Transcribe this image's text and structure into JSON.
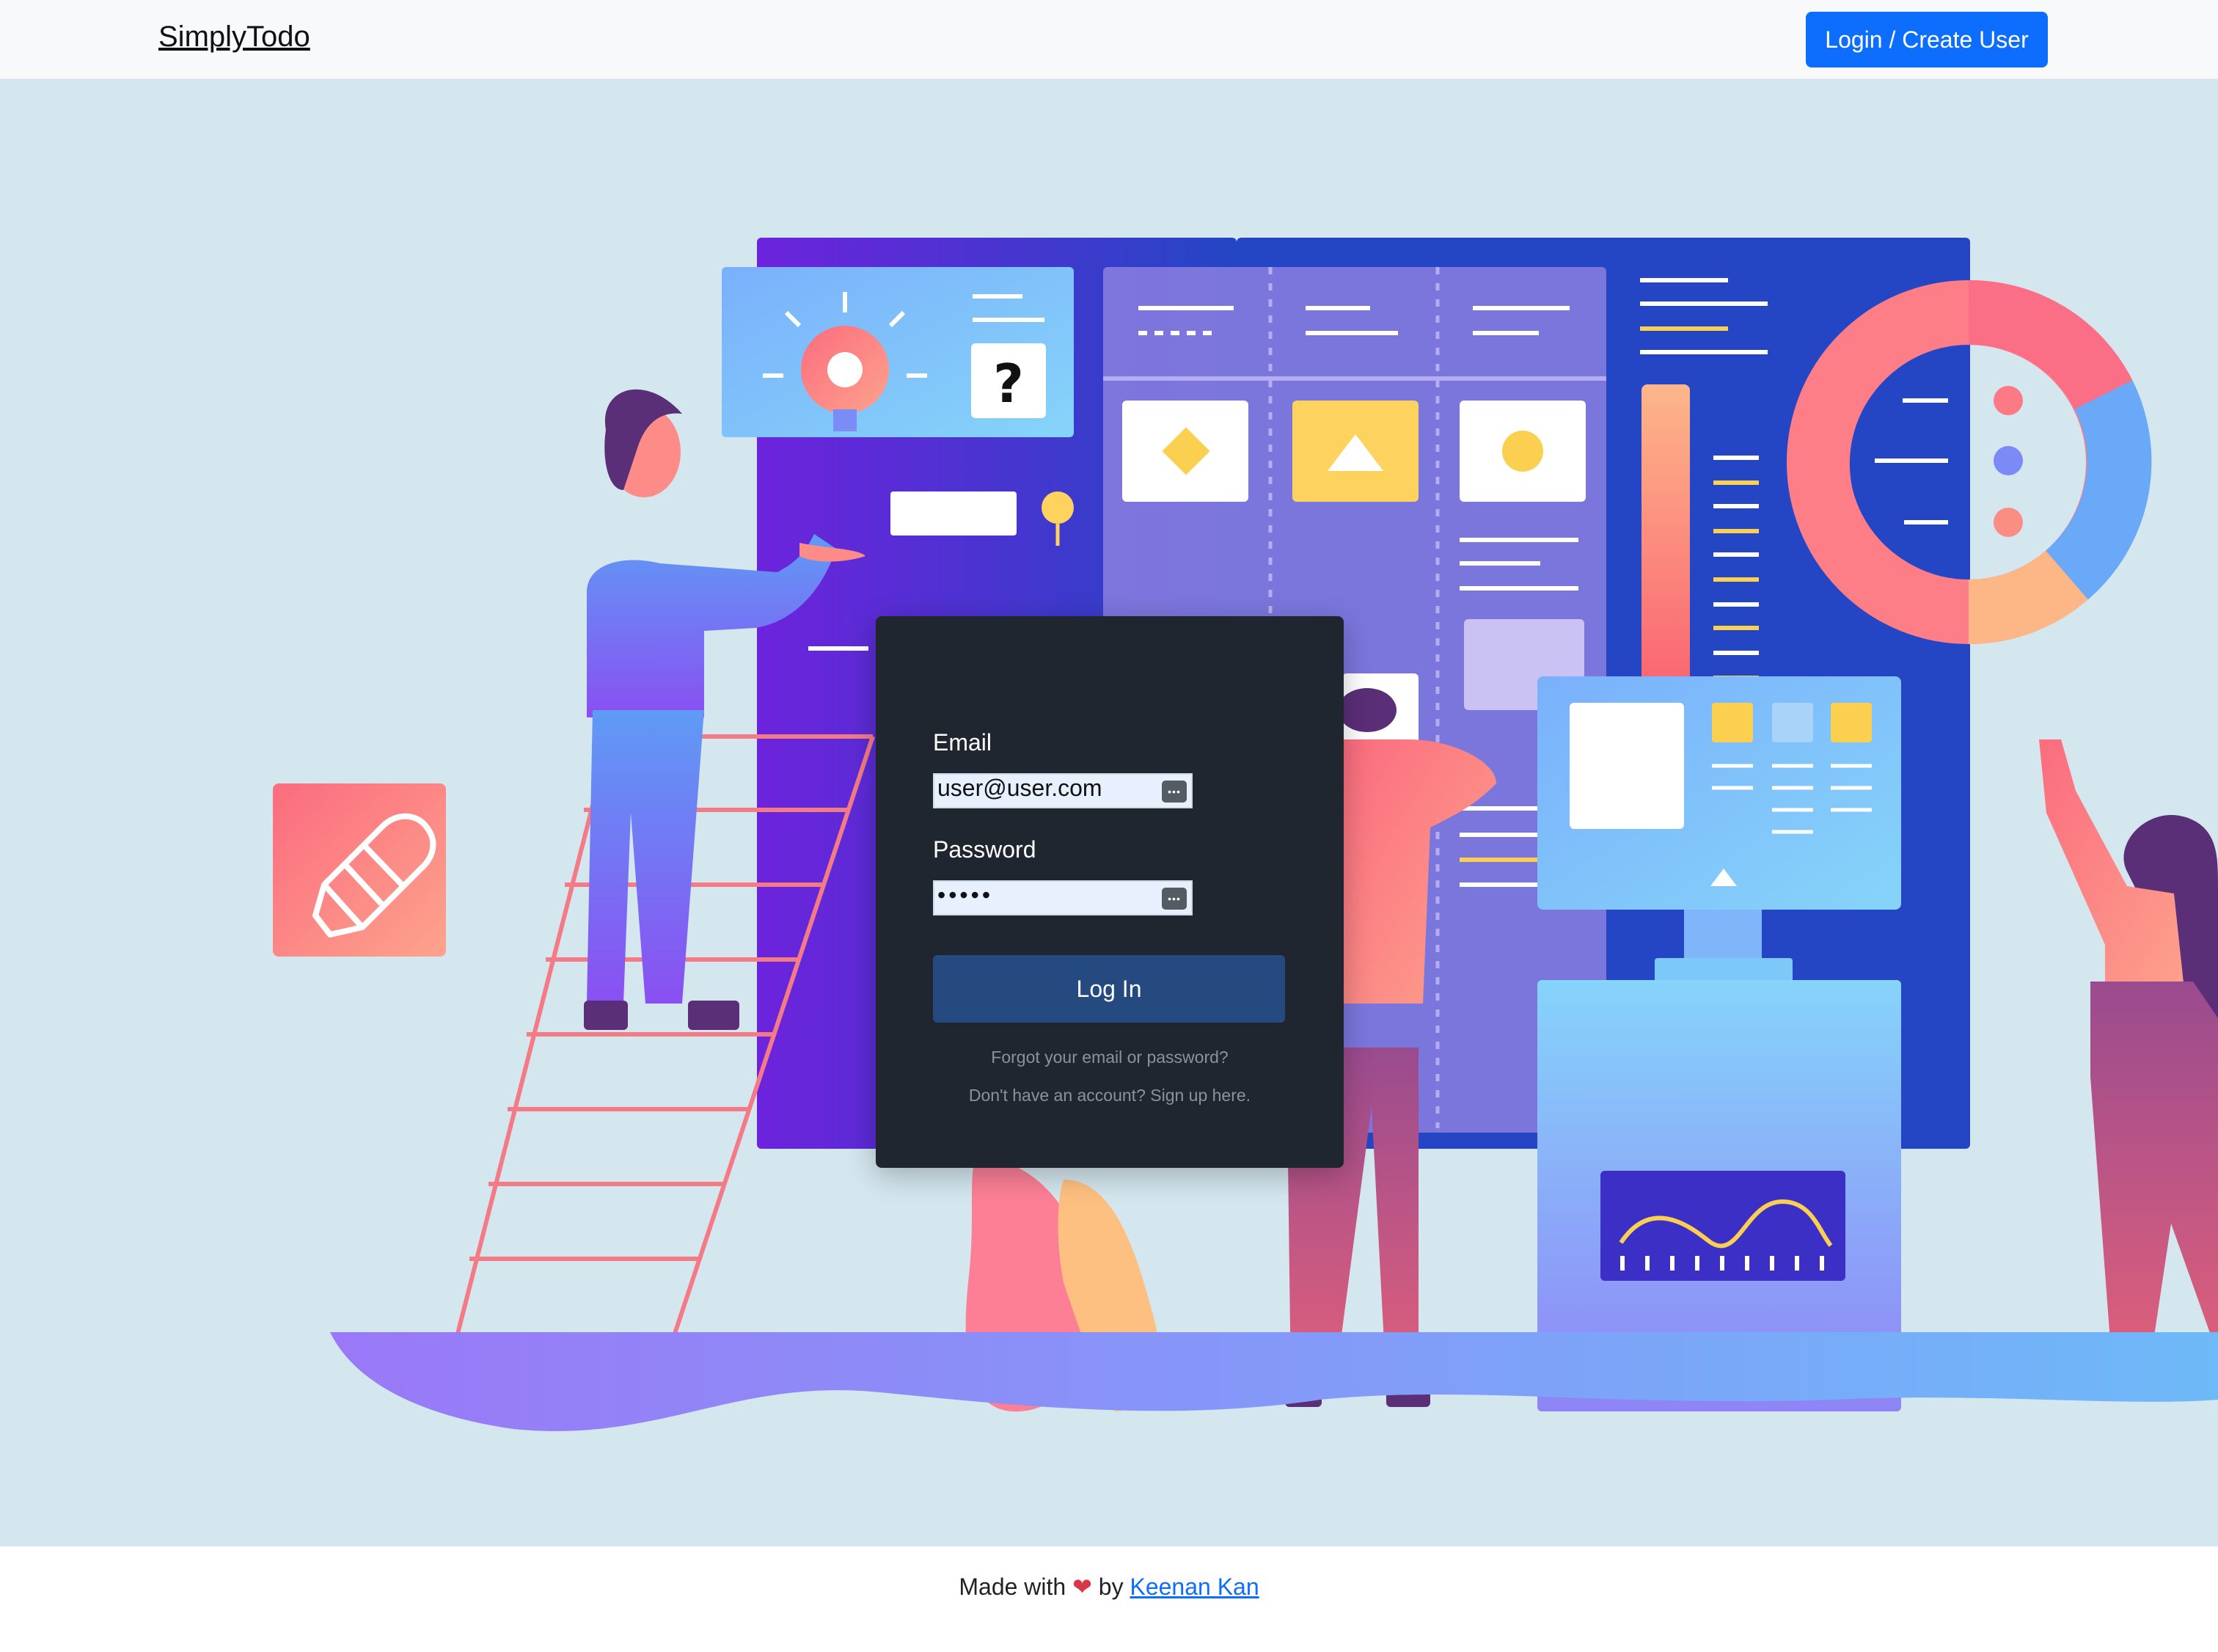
{
  "navbar": {
    "brand": "SimplyTodo",
    "login_button": "Login / Create User"
  },
  "illustration": {
    "question_mark": "?"
  },
  "login": {
    "email_label": "Email",
    "email_value": "user@user.com",
    "password_label": "Password",
    "password_value": "•••••",
    "autofill_icon": "•••",
    "submit_label": "Log In",
    "forgot_link": "Forgot your email or password?",
    "signup_link": "Don't have an account? Sign up here."
  },
  "footer": {
    "made_with": "Made with",
    "heart": "❤",
    "by": "by",
    "author": "Keenan Kan"
  },
  "colors": {
    "brand_primary": "#0d6efd",
    "login_card": "#1f2630",
    "login_button": "#244a80",
    "hero_background": "#d4e6ee",
    "heart": "#dc3545"
  },
  "icons": [
    "pencil-icon",
    "lightbulb-icon",
    "heart-icon",
    "key-autofill-icon"
  ]
}
